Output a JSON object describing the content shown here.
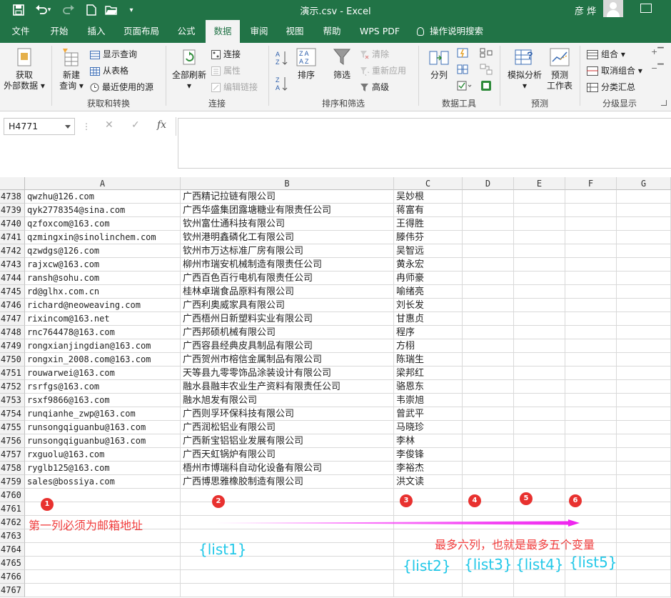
{
  "titlebar": {
    "title": "演示.csv  -  Excel",
    "user": "彦 烨",
    "quick_access": [
      "save-icon",
      "undo-icon",
      "redo-icon",
      "new-file-icon",
      "open-folder-icon",
      "customize-icon"
    ]
  },
  "tabs": [
    "文件",
    "开始",
    "插入",
    "页面布局",
    "公式",
    "数据",
    "审阅",
    "视图",
    "帮助",
    "WPS PDF"
  ],
  "active_tab": "数据",
  "tell_me": "操作说明搜索",
  "ribbon": {
    "get_data": {
      "line1": "获取",
      "line2": "外部数据"
    },
    "new_query": {
      "line1": "新建",
      "line2": "查询"
    },
    "show_query": "显示查询",
    "from_table": "从表格",
    "recent_sources": "最近使用的源",
    "group_get_transform": "获取和转换",
    "refresh_all": "全部刷新",
    "connections": "连接",
    "properties": "属性",
    "edit_links": "编辑链接",
    "group_connections": "连接",
    "sort": "排序",
    "filter": "筛选",
    "clear": "清除",
    "reapply": "重新应用",
    "advanced": "高级",
    "group_sort_filter": "排序和筛选",
    "text_to_columns": "分列",
    "group_data_tools": "数据工具",
    "what_if": "模拟分析",
    "forecast_sheet": {
      "line1": "预测",
      "line2": "工作表"
    },
    "group_forecast": "预测",
    "group": "组合",
    "ungroup": "取消组合",
    "subtotal": "分类汇总",
    "group_outline": "分级显示"
  },
  "formula_bar": {
    "name_box": "H4771",
    "cancel": "✕",
    "enter": "✓",
    "fx": "fx",
    "value": ""
  },
  "columns": [
    "A",
    "B",
    "C",
    "D",
    "E",
    "F",
    "G"
  ],
  "rows": [
    {
      "n": "4738",
      "a": "qwzhu@126.com",
      "b": "广西精记拉链有限公司",
      "c": "吴妙根"
    },
    {
      "n": "4739",
      "a": "qyk2778354@sina.com",
      "b": "广西华盛集团露塘糖业有限责任公司",
      "c": "蒋富有"
    },
    {
      "n": "4740",
      "a": "qzfoxcom@163.com",
      "b": "钦州富仕通科技有限公司",
      "c": "王得胜"
    },
    {
      "n": "4741",
      "a": "qzmingxin@sinolinchem.com",
      "b": "钦州港明鑫磷化工有限公司",
      "c": "滕伟芬"
    },
    {
      "n": "4742",
      "a": "qzwdgs@126.com",
      "b": "钦州市万达标准厂房有限公司",
      "c": "吴智远"
    },
    {
      "n": "4743",
      "a": "rajxcw@163.com",
      "b": "柳州市瑞安机械制造有限责任公司",
      "c": "黄永宏"
    },
    {
      "n": "4744",
      "a": "ransh@sohu.com",
      "b": "广西百色百行电机有限责任公司",
      "c": "冉师豪"
    },
    {
      "n": "4745",
      "a": "rd@glhx.com.cn",
      "b": "桂林卓瑞食品原料有限公司",
      "c": "喻绪亮"
    },
    {
      "n": "4746",
      "a": "richard@neoweaving.com",
      "b": "广西利奥威家具有限公司",
      "c": "刘长发"
    },
    {
      "n": "4747",
      "a": "rixincom@163.net",
      "b": "广西梧州日新塑料实业有限公司",
      "c": "甘惠贞"
    },
    {
      "n": "4748",
      "a": "rnc764478@163.com",
      "b": "广西邦硕机械有限公司",
      "c": "程序"
    },
    {
      "n": "4749",
      "a": "rongxianjingdian@163.com",
      "b": "广西容县经典皮具制品有限公司",
      "c": "方栩"
    },
    {
      "n": "4750",
      "a": "rongxin_2008.com@163.com",
      "b": "广西贺州市榕信金属制品有限公司",
      "c": "陈瑞生"
    },
    {
      "n": "4751",
      "a": "rouwarwei@163.com",
      "b": "天等县九零零饰品涂装设计有限公司",
      "c": "梁邦红"
    },
    {
      "n": "4752",
      "a": "rsrfgs@163.com",
      "b": "融水县融丰农业生产资料有限责任公司",
      "c": "骆恩东"
    },
    {
      "n": "4753",
      "a": "rsxf9866@163.com",
      "b": "融水旭发有限公司",
      "c": "韦崇旭"
    },
    {
      "n": "4754",
      "a": "runqianhe_zwp@163.com",
      "b": "广西则孚环保科技有限公司",
      "c": "曾武平"
    },
    {
      "n": "4755",
      "a": "runsongqiguanbu@163.com",
      "b": "广西润松铝业有限公司",
      "c": "马晓珍"
    },
    {
      "n": "4756",
      "a": "runsongqiguanbu@163.com",
      "b": "广西新宝铝铝业发展有限公司",
      "c": "李林"
    },
    {
      "n": "4757",
      "a": "rxguolu@163.com",
      "b": "广西天虹锅炉有限公司",
      "c": "李俊锋"
    },
    {
      "n": "4758",
      "a": "ryglb125@163.com",
      "b": "梧州市博瑞科自动化设备有限公司",
      "c": "李裕杰"
    },
    {
      "n": "4759",
      "a": "sales@bossiya.com",
      "b": "广西博思雅橡胶制造有限公司",
      "c": "洪文读"
    },
    {
      "n": "4760",
      "a": "",
      "b": "",
      "c": ""
    },
    {
      "n": "4761",
      "a": "",
      "b": "",
      "c": ""
    },
    {
      "n": "4762",
      "a": "",
      "b": "",
      "c": ""
    },
    {
      "n": "4763",
      "a": "",
      "b": "",
      "c": ""
    },
    {
      "n": "4764",
      "a": "",
      "b": "",
      "c": ""
    },
    {
      "n": "4765",
      "a": "",
      "b": "",
      "c": ""
    },
    {
      "n": "4766",
      "a": "",
      "b": "",
      "c": ""
    },
    {
      "n": "4767",
      "a": "",
      "b": "",
      "c": ""
    }
  ],
  "annotations": {
    "badges": [
      "1",
      "2",
      "3",
      "4",
      "5",
      "6"
    ],
    "first_col_note": "第一列必须为邮箱地址",
    "max_cols_note": "最多六列，也就是最多五个变量",
    "list_labels": [
      "{list1}",
      "{list2}",
      "{list3}",
      "{list4}",
      "{list5}"
    ],
    "colors": {
      "badge": "#e8312f",
      "red_text": "#f03c3c",
      "cyan_text": "#22c8e8",
      "arrow": "#ee22ee"
    }
  }
}
